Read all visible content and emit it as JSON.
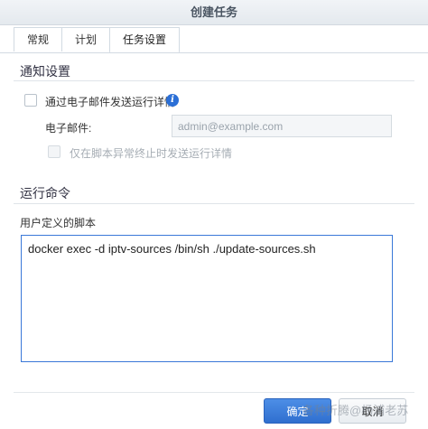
{
  "window": {
    "title": "创建任务"
  },
  "tabs": [
    {
      "label": "常规"
    },
    {
      "label": "计划"
    },
    {
      "label": "任务设置"
    }
  ],
  "notification": {
    "section_title": "通知设置",
    "email_checkbox_label": "通过电子邮件发送运行详情",
    "email_label": "电子邮件:",
    "email_placeholder": "admin@example.com",
    "abnormal_only_label": "仅在脚本异常终止时发送运行详情",
    "email_checked": false,
    "abnormal_only_checked": false
  },
  "run_command": {
    "section_title": "运行命令",
    "script_label": "用户定义的脚本",
    "script_value": "docker exec -d iptv-sources /bin/sh ./update-sources.sh"
  },
  "footer": {
    "ok_label": "确定",
    "cancel_label": "取消"
  },
  "watermark": "各种折腾@杨浦老苏",
  "colors": {
    "accent": "#2f6fcf",
    "info_icon": "#2b6fd6"
  },
  "icons": {
    "info": "info-icon"
  }
}
